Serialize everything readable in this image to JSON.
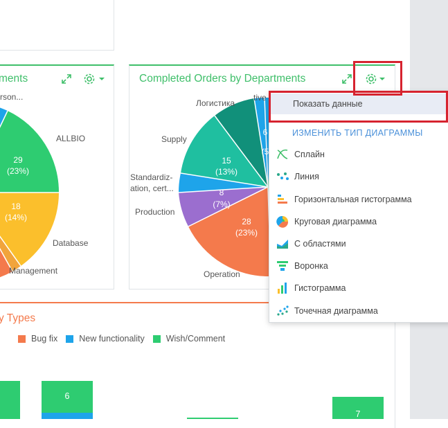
{
  "left_panel": {
    "title_fragment": "ments",
    "labels": {
      "person": "rson...",
      "allbio": "ALLBIO",
      "database": "Database",
      "management": "Management"
    },
    "slices": [
      {
        "value": "29",
        "pct": "(23%)",
        "color": "#2ecc71"
      },
      {
        "value": "18",
        "pct": "(14%)",
        "color": "#fbbf2c"
      }
    ]
  },
  "mid_panel": {
    "title": "Completed Orders by Departments",
    "labels": {
      "logistics": "Логистика",
      "tive": "tive",
      "supply": "Supply",
      "standard_1": "Standardiz-",
      "standard_2": "ation, cert...",
      "production": "Production",
      "operation": "Operation"
    },
    "slices": [
      {
        "value": "15",
        "pct": "(13%)"
      },
      {
        "value": "8",
        "pct": "(7%)"
      },
      {
        "value": "28",
        "pct": "(23%)"
      },
      {
        "value": "6",
        "pct": "(5"
      }
    ]
  },
  "bottom_panel": {
    "title_fragment": "y Types",
    "legend": [
      {
        "label": "Bug fix",
        "color": "#f47a4c"
      },
      {
        "label": "New functionality",
        "color": "#1ea4ea"
      },
      {
        "label": "Wish/Comment",
        "color": "#2ecc71"
      }
    ],
    "bar_values": [
      "6",
      "7"
    ]
  },
  "menu": {
    "show_data": "Показать данные",
    "change_type_header": "ИЗМЕНИТЬ ТИП ДИАГРАММЫ",
    "items": [
      {
        "label": "Сплайн",
        "icon": "spline-icon"
      },
      {
        "label": "Линия",
        "icon": "line-icon"
      },
      {
        "label": "Горизонтальная гистограмма",
        "icon": "horizontal-bar-icon"
      },
      {
        "label": "Круговая диаграмма",
        "icon": "pie-icon"
      },
      {
        "label": "С областями",
        "icon": "area-icon"
      },
      {
        "label": "Воронка",
        "icon": "funnel-icon"
      },
      {
        "label": "Гистограмма",
        "icon": "bar-icon"
      },
      {
        "label": "Точечная диаграмма",
        "icon": "scatter-icon"
      }
    ]
  },
  "colors": {
    "green": "#3fbf6a",
    "orange": "#f47a4c",
    "blue": "#1ea4ea",
    "highlight_red": "#d6232f",
    "menu_blue": "#4a90d9"
  }
}
